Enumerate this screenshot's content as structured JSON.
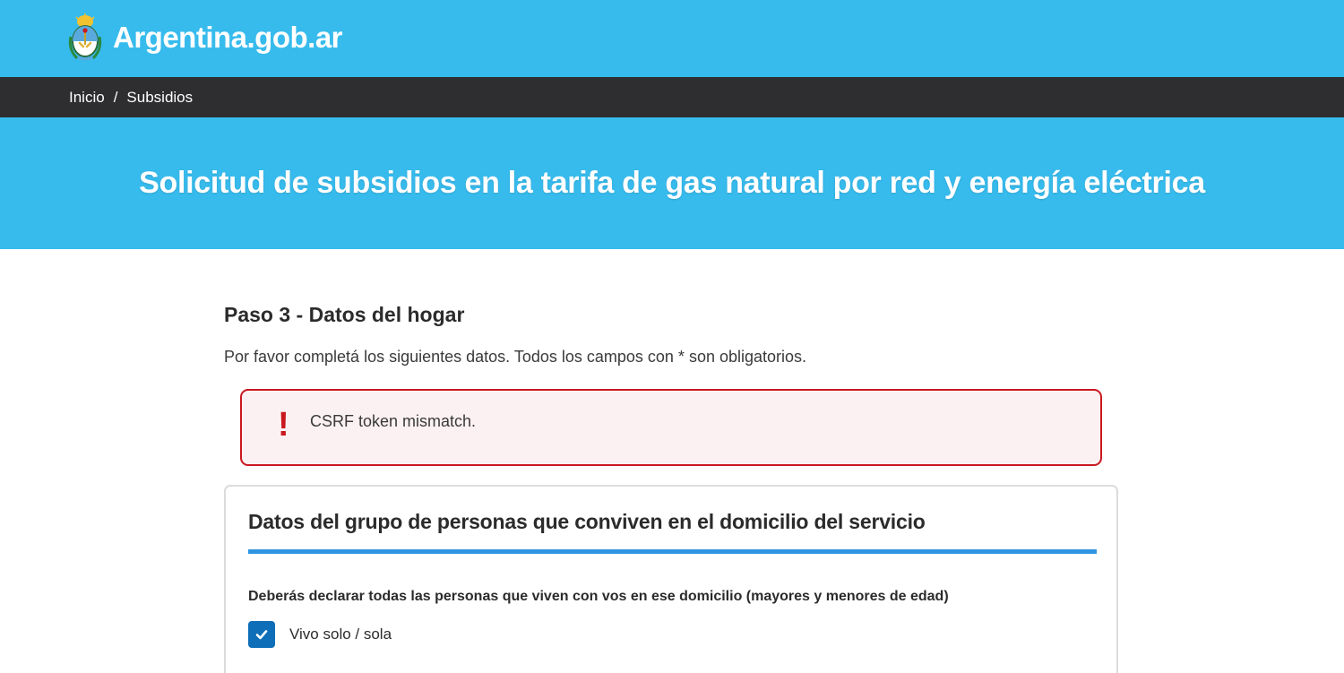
{
  "header": {
    "logo_icon": "argentina-coat-of-arms-icon",
    "site_name": "Argentina.gob.ar",
    "background_color": "#37bbed"
  },
  "breadcrumb": {
    "items": [
      "Inicio",
      "Subsidios"
    ],
    "separator": "/"
  },
  "hero": {
    "title": "Solicitud de subsidios en la tarifa de gas natural por red y energía eléctrica"
  },
  "step": {
    "title": "Paso 3 - Datos del hogar",
    "description": "Por favor completá los siguientes datos. Todos los campos con * son obligatorios."
  },
  "alert": {
    "icon": "exclamation-icon",
    "icon_glyph": "!",
    "message": "CSRF token mismatch.",
    "color": "#c9181f"
  },
  "section": {
    "title": "Datos del grupo de personas que conviven en el domicilio del servicio",
    "instructions": "Deberás declarar todas las personas que viven con vos en ese domicilio (mayores y menores de edad)",
    "accent_color": "#2f95e1",
    "checkbox": {
      "label": "Vivo solo / sola",
      "checked": true,
      "icon": "check-icon"
    }
  }
}
